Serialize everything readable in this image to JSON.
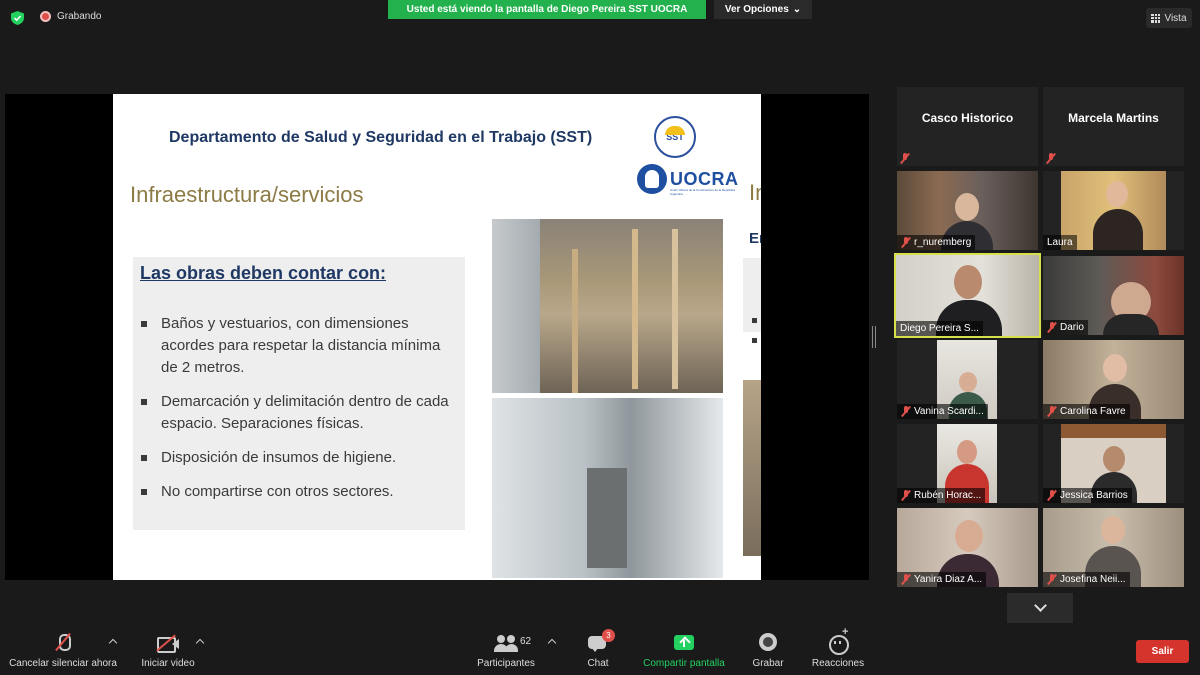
{
  "top": {
    "recording_label": "Grabando",
    "share_banner": "Usted está viendo la pantalla de Diego Pereira SST UOCRA",
    "view_options": "Ver Opciones",
    "view_button": "Vista"
  },
  "slide": {
    "header": "Departamento de Salud y Seguridad en el Trabajo (SST)",
    "sst_logo_text": "SST",
    "uocra_text": "UOCRA",
    "uocra_subtitle": "Unión Obrera de la Construcción de la República Argentina",
    "title": "Infraestructura/servicios",
    "box_title": "Las obras deben contar con:",
    "bullets": [
      "Baños y vestuarios, con dimensiones acordes para respetar la distancia mínima de 2 metros.",
      "Demarcación y delimitación dentro de cada espacio. Separaciones físicas.",
      "Disposición de insumos de higiene.",
      "No compartirse con otros sectores."
    ],
    "next_slide_peek_title": "In",
    "next_slide_peek_subtitle": "En"
  },
  "participants": [
    {
      "name": "Casco Historico",
      "video": false,
      "muted": true
    },
    {
      "name": "Marcela Martins",
      "video": false,
      "muted": true
    },
    {
      "name": "r_nuremberg",
      "video": true,
      "muted": true
    },
    {
      "name": "Laura",
      "video": true,
      "muted": false
    },
    {
      "name": "Diego Pereira S...",
      "video": true,
      "muted": false,
      "active_speaker": true
    },
    {
      "name": "Dario",
      "video": true,
      "muted": true
    },
    {
      "name": "Vanina Scardi...",
      "video": true,
      "muted": true
    },
    {
      "name": "Carolina Favre",
      "video": true,
      "muted": true
    },
    {
      "name": "Rubén Horac...",
      "video": true,
      "muted": true
    },
    {
      "name": "Jessica Barrios",
      "video": true,
      "muted": true
    },
    {
      "name": "Yanira Diaz A...",
      "video": true,
      "muted": true
    },
    {
      "name": "Josefina Neii...",
      "video": true,
      "muted": true
    }
  ],
  "toolbar": {
    "unmute_label": "Cancelar silenciar ahora",
    "start_video_label": "Iniciar video",
    "participants_label": "Participantes",
    "participants_count": "62",
    "chat_label": "Chat",
    "chat_badge": "3",
    "share_label": "Compartir pantalla",
    "record_label": "Grabar",
    "reactions_label": "Reacciones",
    "leave_label": "Salir"
  },
  "colors": {
    "share_banner_bg": "#22b14c",
    "active_speaker_border": "#d6e04a",
    "leave_button": "#d5342c",
    "share_icon": "#23d160",
    "muted_red": "#e0504a"
  }
}
